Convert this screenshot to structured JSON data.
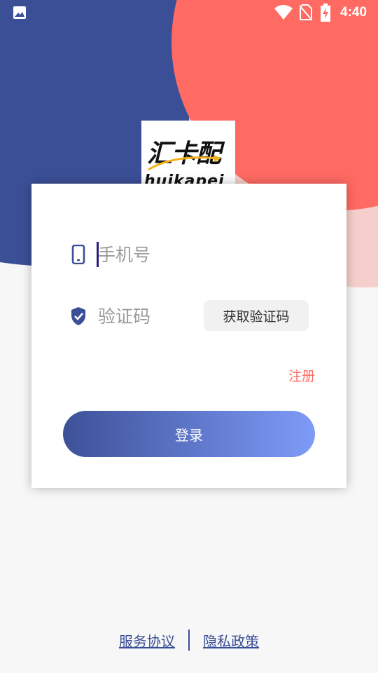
{
  "status_bar": {
    "time": "4:40",
    "icons": [
      "gallery-icon",
      "wifi-icon",
      "sim-disabled-icon",
      "battery-charging-icon"
    ]
  },
  "logo": {
    "chinese": "汇卡配",
    "pinyin": "huikapei"
  },
  "form": {
    "phone": {
      "placeholder": "手机号",
      "value": "",
      "icon": "phone-icon"
    },
    "code": {
      "placeholder": "验证码",
      "value": "",
      "icon": "shield-check-icon"
    },
    "get_code_label": "获取验证码",
    "register_label": "注册",
    "login_label": "登录"
  },
  "footer": {
    "service_agreement": "服务协议",
    "privacy_policy": "隐私政策"
  },
  "colors": {
    "navy": "#3b4f96",
    "coral": "#ff6a62",
    "gradient_start": "#3d5198",
    "gradient_end": "#7e9bf8"
  }
}
